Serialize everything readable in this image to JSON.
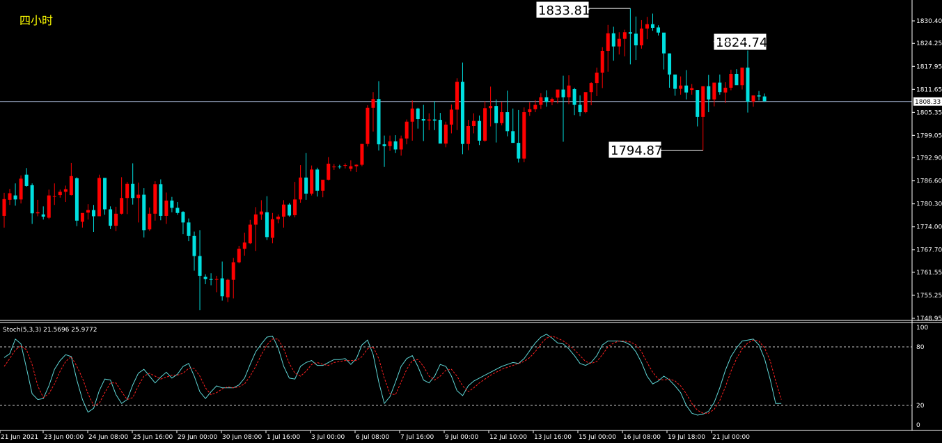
{
  "timeframe_label": "四小时",
  "indicator": {
    "name": "Stoch(5,3,3)",
    "main_value": "21.5696",
    "signal_value": "25.9772",
    "levels": [
      80,
      20
    ],
    "axis_ticks": [
      "100",
      "80",
      "20",
      "0"
    ]
  },
  "colors": {
    "background": "#000000",
    "bull_candle": "#ff0000",
    "bear_candle": "#00e0e0",
    "stoch_main": "#5fd7d7",
    "stoch_signal": "#ff2020",
    "grid_line": "#c8c8c8",
    "current_price_line": "#a8b8d8"
  },
  "current_price": "1808.33",
  "callouts": [
    {
      "label": "1833.81",
      "kind": "high"
    },
    {
      "label": "1824.74",
      "kind": "high"
    },
    {
      "label": "1794.87",
      "kind": "low"
    }
  ],
  "chart_data": [
    {
      "type": "candlestick",
      "title": "",
      "price_axis_ticks": [
        "1830.40",
        "1824.25",
        "1817.95",
        "1811.65",
        "1805.35",
        "1799.05",
        "1792.90",
        "1786.60",
        "1780.30",
        "1774.00",
        "1767.70",
        "1761.55",
        "1755.25",
        "1748.95"
      ],
      "time_axis_labels": [
        "21 Jun 2021",
        "23 Jun 00:00",
        "24 Jun 08:00",
        "25 Jun 16:00",
        "29 Jun 00:00",
        "30 Jun 08:00",
        "1 Jul 16:00",
        "3 Jul 00:00",
        "6 Jul 08:00",
        "7 Jul 16:00",
        "9 Jul 00:00",
        "12 Jul 10:00",
        "13 Jul 16:00",
        "15 Jul 00:00",
        "16 Jul 08:00",
        "19 Jul 18:00",
        "21 Jul 00:00"
      ],
      "ylim": [
        1748.95,
        1833.9
      ],
      "ohlc": [
        [
          1777.0,
          1783.3,
          1773.8,
          1781.6
        ],
        [
          1781.4,
          1784.4,
          1780.0,
          1783.2
        ],
        [
          1782.6,
          1785.9,
          1779.8,
          1781.5
        ],
        [
          1781.5,
          1788.1,
          1780.4,
          1787.2
        ],
        [
          1788.3,
          1790.1,
          1785.0,
          1785.2
        ],
        [
          1785.4,
          1785.9,
          1774.8,
          1777.7
        ],
        [
          1777.7,
          1781.4,
          1776.9,
          1778.0
        ],
        [
          1777.4,
          1779.6,
          1776.0,
          1776.8
        ],
        [
          1776.5,
          1784.2,
          1776.1,
          1782.6
        ],
        [
          1782.4,
          1785.9,
          1780.0,
          1782.4
        ],
        [
          1782.7,
          1784.2,
          1782.0,
          1783.6
        ],
        [
          1783.6,
          1785.3,
          1780.8,
          1784.3
        ],
        [
          1782.7,
          1791.5,
          1782.6,
          1787.9
        ],
        [
          1787.3,
          1787.6,
          1774.2,
          1775.7
        ],
        [
          1775.4,
          1777.7,
          1773.8,
          1777.8
        ],
        [
          1777.9,
          1780.2,
          1776.0,
          1778.6
        ],
        [
          1778.6,
          1780.0,
          1772.6,
          1776.9
        ],
        [
          1776.9,
          1788.3,
          1777.0,
          1787.4
        ],
        [
          1787.4,
          1787.4,
          1777.3,
          1778.8
        ],
        [
          1778.8,
          1779.6,
          1773.4,
          1774.3
        ],
        [
          1774.3,
          1779.5,
          1772.8,
          1777.6
        ],
        [
          1777.6,
          1787.6,
          1777.4,
          1781.9
        ],
        [
          1781.9,
          1786.3,
          1777.5,
          1785.8
        ],
        [
          1785.8,
          1791.4,
          1780.1,
          1781.9
        ],
        [
          1781.9,
          1786.1,
          1775.2,
          1782.8
        ],
        [
          1782.8,
          1784.6,
          1771.1,
          1773.1
        ],
        [
          1773.3,
          1779.3,
          1772.9,
          1777.6
        ],
        [
          1777.6,
          1786.5,
          1775.7,
          1785.7
        ],
        [
          1785.7,
          1787.0,
          1775.8,
          1777.0
        ],
        [
          1777.0,
          1783.4,
          1774.8,
          1781.2
        ],
        [
          1781.2,
          1782.2,
          1778.0,
          1779.2
        ],
        [
          1779.2,
          1780.8,
          1777.3,
          1777.8
        ],
        [
          1778.1,
          1778.3,
          1772.0,
          1775.2
        ],
        [
          1775.2,
          1776.3,
          1770.1,
          1771.5
        ],
        [
          1771.5,
          1772.7,
          1762.0,
          1766.0
        ],
        [
          1766.0,
          1773.1,
          1751.2,
          1760.6
        ],
        [
          1760.3,
          1761.0,
          1758.3,
          1759.7
        ],
        [
          1759.7,
          1761.3,
          1758.0,
          1759.5
        ],
        [
          1759.7,
          1760.6,
          1756.1,
          1759.7
        ],
        [
          1759.9,
          1764.5,
          1753.8,
          1755.0
        ],
        [
          1754.7,
          1759.8,
          1753.4,
          1759.5
        ],
        [
          1759.5,
          1765.5,
          1754.4,
          1764.3
        ],
        [
          1764.3,
          1768.8,
          1764.0,
          1768.0
        ],
        [
          1768.0,
          1772.4,
          1766.1,
          1769.7
        ],
        [
          1769.5,
          1775.9,
          1769.3,
          1774.6
        ],
        [
          1774.6,
          1779.4,
          1767.4,
          1777.4
        ],
        [
          1777.4,
          1781.3,
          1775.9,
          1778.2
        ],
        [
          1778.0,
          1782.4,
          1770.4,
          1771.2
        ],
        [
          1771.0,
          1777.8,
          1769.5,
          1776.1
        ],
        [
          1776.1,
          1777.4,
          1775.0,
          1776.8
        ],
        [
          1776.8,
          1781.3,
          1773.8,
          1780.1
        ],
        [
          1780.1,
          1780.5,
          1776.8,
          1777.1
        ],
        [
          1777.2,
          1786.3,
          1776.6,
          1781.5
        ],
        [
          1781.5,
          1790.9,
          1780.6,
          1787.5
        ],
        [
          1787.5,
          1794.2,
          1781.4,
          1783.1
        ],
        [
          1783.1,
          1790.8,
          1782.6,
          1789.7
        ],
        [
          1789.7,
          1790.2,
          1782.3,
          1783.9
        ],
        [
          1783.9,
          1786.3,
          1782.1,
          1786.9
        ],
        [
          1786.9,
          1793.1,
          1786.7,
          1791.3
        ],
        [
          1790.4,
          1791.2,
          1789.6,
          1790.5
        ],
        [
          1790.5,
          1791.0,
          1789.9,
          1790.4
        ],
        [
          1790.8,
          1791.4,
          1790.0,
          1790.9
        ],
        [
          1789.9,
          1792.2,
          1789.2,
          1790.6
        ],
        [
          1790.6,
          1791.1,
          1789.0,
          1791.0
        ],
        [
          1791.0,
          1794.1,
          1790.6,
          1796.7
        ],
        [
          1796.7,
          1807.3,
          1796.0,
          1806.6
        ],
        [
          1806.6,
          1810.9,
          1800.1,
          1809.0
        ],
        [
          1809.0,
          1813.9,
          1794.9,
          1796.6
        ],
        [
          1796.6,
          1799.0,
          1790.4,
          1796.1
        ],
        [
          1796.1,
          1799.0,
          1794.8,
          1797.4
        ],
        [
          1797.4,
          1799.1,
          1794.2,
          1795.2
        ],
        [
          1795.2,
          1799.0,
          1793.5,
          1798.2
        ],
        [
          1798.2,
          1803.4,
          1796.6,
          1802.8
        ],
        [
          1802.8,
          1808.6,
          1797.6,
          1806.4
        ],
        [
          1806.4,
          1806.6,
          1800.9,
          1803.5
        ],
        [
          1803.5,
          1807.4,
          1797.5,
          1803.1
        ],
        [
          1803.1,
          1805.1,
          1800.5,
          1803.4
        ],
        [
          1803.4,
          1808.4,
          1800.5,
          1803.1
        ],
        [
          1803.3,
          1805.2,
          1797.8,
          1796.8
        ],
        [
          1796.8,
          1802.8,
          1795.8,
          1802.0
        ],
        [
          1802.0,
          1807.5,
          1799.6,
          1806.1
        ],
        [
          1806.1,
          1814.7,
          1800.5,
          1813.7
        ],
        [
          1813.7,
          1819.0,
          1793.9,
          1796.7
        ],
        [
          1796.7,
          1803.3,
          1795.0,
          1801.6
        ],
        [
          1801.6,
          1805.1,
          1799.6,
          1803.0
        ],
        [
          1803.0,
          1804.5,
          1796.4,
          1797.6
        ],
        [
          1797.6,
          1808.4,
          1797.3,
          1806.5
        ],
        [
          1806.5,
          1812.4,
          1801.5,
          1807.1
        ],
        [
          1807.1,
          1808.9,
          1797.1,
          1802.4
        ],
        [
          1802.4,
          1808.2,
          1801.8,
          1805.4
        ],
        [
          1805.4,
          1811.3,
          1798.8,
          1800.2
        ],
        [
          1800.2,
          1806.4,
          1797.0,
          1797.0
        ],
        [
          1797.0,
          1806.0,
          1791.6,
          1792.7
        ],
        [
          1792.7,
          1806.7,
          1791.7,
          1805.4
        ],
        [
          1805.4,
          1808.1,
          1804.4,
          1806.2
        ],
        [
          1806.2,
          1808.7,
          1805.4,
          1807.4
        ],
        [
          1807.4,
          1810.6,
          1806.3,
          1809.5
        ],
        [
          1809.5,
          1811.4,
          1806.9,
          1808.2
        ],
        [
          1808.2,
          1809.4,
          1807.3,
          1809.0
        ],
        [
          1809.4,
          1810.3,
          1807.8,
          1811.6
        ],
        [
          1811.6,
          1815.4,
          1797.3,
          1809.5
        ],
        [
          1809.5,
          1815.5,
          1807.6,
          1812.7
        ],
        [
          1811.7,
          1812.1,
          1804.6,
          1807.4
        ],
        [
          1807.4,
          1810.0,
          1804.3,
          1805.4
        ],
        [
          1805.4,
          1808.6,
          1805.1,
          1810.9
        ],
        [
          1810.9,
          1813.6,
          1807.3,
          1813.4
        ],
        [
          1813.4,
          1817.6,
          1809.8,
          1816.2
        ],
        [
          1816.2,
          1823.2,
          1812.0,
          1822.2
        ],
        [
          1822.2,
          1829.3,
          1816.5,
          1827.0
        ],
        [
          1827.0,
          1828.8,
          1819.5,
          1823.4
        ],
        [
          1823.4,
          1827.3,
          1821.2,
          1825.5
        ],
        [
          1825.5,
          1828.0,
          1820.7,
          1827.3
        ],
        [
          1827.3,
          1833.8,
          1818.5,
          1826.9
        ],
        [
          1826.9,
          1831.6,
          1819.7,
          1823.7
        ],
        [
          1823.7,
          1830.6,
          1822.8,
          1828.3
        ],
        [
          1828.3,
          1831.5,
          1825.4,
          1829.5
        ],
        [
          1829.5,
          1832.4,
          1827.7,
          1828.5
        ],
        [
          1828.6,
          1829.2,
          1826.4,
          1827.2
        ],
        [
          1827.2,
          1826.9,
          1817.1,
          1821.5
        ],
        [
          1821.5,
          1821.5,
          1812.1,
          1815.7
        ],
        [
          1815.7,
          1815.6,
          1809.9,
          1811.8
        ],
        [
          1811.8,
          1815.2,
          1810.2,
          1812.7
        ],
        [
          1812.7,
          1816.9,
          1808.9,
          1810.8
        ],
        [
          1811.5,
          1813.1,
          1810.2,
          1812.0
        ],
        [
          1811.5,
          1810.6,
          1801.5,
          1804.1
        ],
        [
          1804.1,
          1809.9,
          1794.9,
          1812.5
        ],
        [
          1812.5,
          1815.6,
          1805.4,
          1808.9
        ],
        [
          1808.9,
          1812.2,
          1807.0,
          1813.5
        ],
        [
          1813.5,
          1815.7,
          1810.2,
          1810.9
        ],
        [
          1810.8,
          1813.6,
          1807.9,
          1812.1
        ],
        [
          1812.1,
          1817.0,
          1811.4,
          1815.9
        ],
        [
          1815.9,
          1817.2,
          1813.2,
          1812.8
        ],
        [
          1812.8,
          1817.6,
          1811.6,
          1817.6
        ],
        [
          1817.6,
          1824.7,
          1805.3,
          1808.3
        ],
        [
          1808.3,
          1810.0,
          1806.9,
          1810.0
        ],
        [
          1810.0,
          1811.2,
          1808.6,
          1809.7
        ],
        [
          1809.7,
          1810.5,
          1808.2,
          1808.4
        ]
      ]
    },
    {
      "type": "line",
      "title": "Stoch(5,3,3) 21.5696 25.9772",
      "ylim": [
        0,
        100
      ],
      "series": [
        {
          "name": "",
          "values": [
            69,
            73,
            88,
            83,
            58,
            32,
            26,
            27,
            40,
            57,
            66,
            72,
            70,
            46,
            26,
            13,
            17,
            35,
            47,
            46,
            31,
            22,
            26,
            41,
            53,
            57,
            50,
            43,
            49,
            54,
            48,
            52,
            60,
            63,
            50,
            34,
            27,
            34,
            40,
            38,
            38,
            38,
            41,
            48,
            62,
            75,
            83,
            90,
            91,
            79,
            60,
            48,
            47,
            60,
            64,
            66,
            61,
            61,
            64,
            67,
            67,
            68,
            62,
            68,
            82,
            87,
            72,
            44,
            22,
            29,
            44,
            60,
            68,
            71,
            60,
            46,
            43,
            50,
            62,
            60,
            50,
            35,
            30,
            40,
            45,
            48,
            51,
            54,
            57,
            60,
            62,
            64,
            63,
            68,
            76,
            84,
            90,
            93,
            89,
            84,
            83,
            78,
            71,
            63,
            61,
            64,
            71,
            82,
            86,
            86,
            86,
            85,
            82,
            75,
            64,
            50,
            42,
            45,
            50,
            46,
            40,
            33,
            20,
            12,
            10,
            11,
            14,
            23,
            38,
            56,
            70,
            79,
            86,
            87,
            88,
            82,
            68,
            47,
            22,
            22
          ]
        },
        {
          "name": "",
          "values": [
            60,
            68,
            77,
            81,
            77,
            62,
            40,
            28,
            32,
            42,
            55,
            65,
            70,
            60,
            48,
            32,
            20,
            22,
            33,
            43,
            43,
            34,
            26,
            28,
            40,
            50,
            53,
            50,
            47,
            49,
            51,
            51,
            53,
            58,
            58,
            50,
            38,
            31,
            33,
            37,
            39,
            38,
            39,
            42,
            50,
            60,
            72,
            82,
            88,
            88,
            78,
            63,
            53,
            50,
            55,
            62,
            64,
            62,
            61,
            64,
            65,
            66,
            66,
            66,
            70,
            78,
            80,
            68,
            48,
            32,
            31,
            44,
            57,
            66,
            67,
            60,
            50,
            46,
            50,
            56,
            57,
            50,
            40,
            34,
            38,
            43,
            47,
            51,
            54,
            57,
            59,
            61,
            63,
            65,
            69,
            75,
            83,
            89,
            91,
            89,
            86,
            82,
            77,
            71,
            65,
            63,
            65,
            72,
            80,
            84,
            86,
            86,
            85,
            82,
            75,
            64,
            54,
            47,
            46,
            47,
            45,
            40,
            32,
            22,
            15,
            12,
            12,
            16,
            25,
            39,
            55,
            68,
            78,
            84,
            87,
            86,
            79,
            66,
            45,
            26
          ]
        }
      ]
    }
  ]
}
